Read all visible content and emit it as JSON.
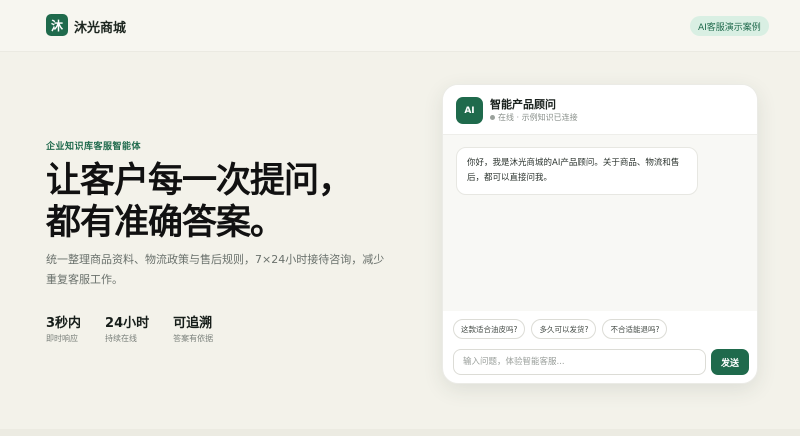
{
  "header": {
    "logo_char": "沐",
    "brand": "沐光商城",
    "demo_badge": "AI客服演示案例"
  },
  "hero": {
    "eyebrow": "企业知识库客服智能体",
    "headline_line1": "让客户每一次提问，",
    "headline_line2": "都有准确答案。",
    "subtitle": "统一整理商品资料、物流政策与售后规则，7×24小时接待咨询，减少重复客服工作。"
  },
  "stats": [
    {
      "value": "3秒内",
      "label": "即时响应"
    },
    {
      "value": "24小时",
      "label": "持续在线"
    },
    {
      "value": "可追溯",
      "label": "答案有依据"
    }
  ],
  "chat": {
    "avatar": "AI",
    "title": "智能产品顾问",
    "status": "在线 · 示例知识已连接",
    "greeting": "你好，我是沐光商城的AI产品顾问。关于商品、物流和售后，都可以直接问我。",
    "chips": [
      "这款适合油皮吗?",
      "多久可以发货?",
      "不合适能退吗?"
    ],
    "input_placeholder": "输入问题，体验智能客服...",
    "send_label": "发送"
  },
  "colors": {
    "accent": "#1f6a4c",
    "background": "#f3f2ea",
    "badge_bg": "#d9efe3"
  }
}
